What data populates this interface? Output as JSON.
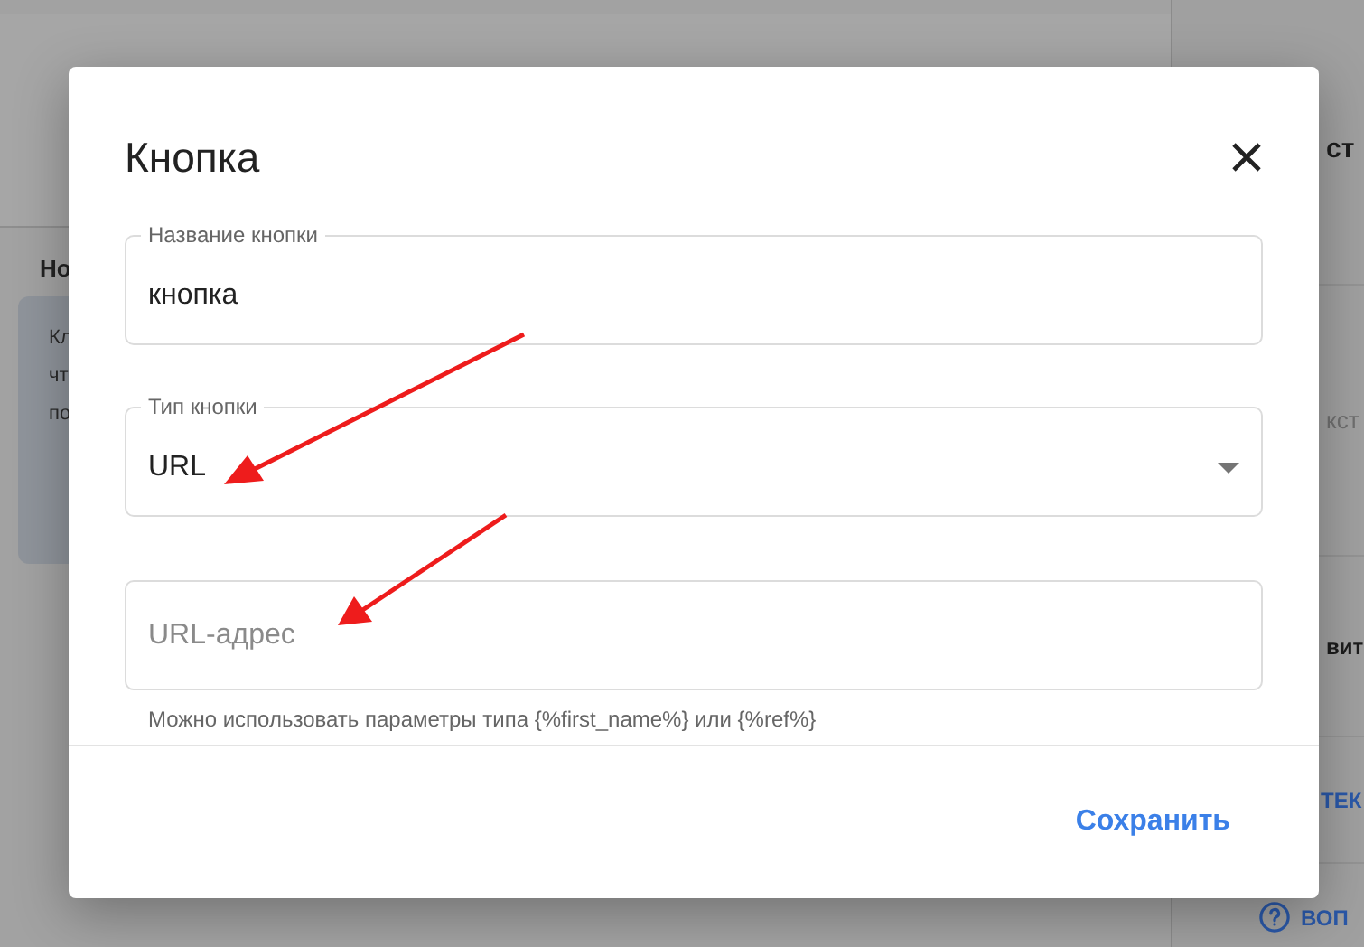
{
  "background": {
    "left_heading": "Но",
    "left_card_lines": [
      "Кл",
      "чт",
      "по"
    ],
    "right_items": [
      {
        "kind": "heading",
        "text": "ст"
      },
      {
        "kind": "hint",
        "text": "кст"
      },
      {
        "kind": "heading",
        "text": "вит"
      },
      {
        "kind": "link",
        "text": "ТЕК"
      },
      {
        "kind": "help",
        "text": "ВОП"
      }
    ]
  },
  "dialog": {
    "title": "Кнопка",
    "fields": [
      {
        "kind": "text",
        "label": "Название кнопки",
        "value": "кнопка"
      },
      {
        "kind": "select",
        "label": "Тип кнопки",
        "value": "URL"
      },
      {
        "kind": "text",
        "placeholder": "URL-адрес",
        "helper": "Можно использовать параметры типа {%first_name%} или {%ref%}"
      }
    ],
    "save_button": "Сохранить"
  }
}
